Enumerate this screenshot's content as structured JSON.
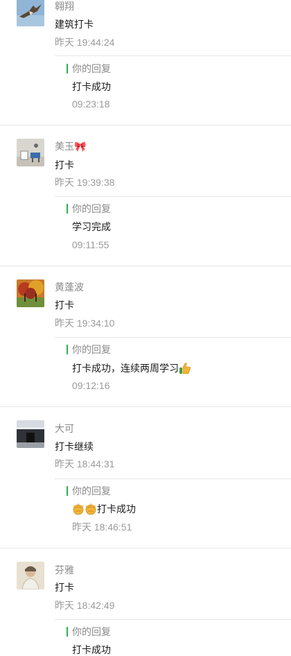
{
  "comments": [
    {
      "avatar_icon": "hawk-avatar",
      "name": "翱翔",
      "content": "建筑打卡",
      "time": "昨天 19:44:24",
      "reply_label": "你的回复",
      "reply_text": "打卡成功",
      "reply_time": "09:23:18"
    },
    {
      "avatar_icon": "room-avatar",
      "name": "美玉🎀",
      "content": "打卡",
      "time": "昨天 19:39:38",
      "reply_label": "你的回复",
      "reply_text": "学习完成",
      "reply_time": "09:11:55"
    },
    {
      "avatar_icon": "autumn-tree-avatar",
      "name": "黄蓬波",
      "content": "打卡",
      "time": "昨天 19:34:10",
      "reply_label": "你的回复",
      "reply_text": "打卡成功，连续两周学习",
      "reply_emoji": "thumbs-up-icon",
      "reply_time": "09:12:16"
    },
    {
      "avatar_icon": "building-avatar",
      "name": "大可",
      "content": "打卡继续",
      "time": "昨天 18:44:31",
      "reply_label": "你的回复",
      "reply_emoji_prefix": "fist-icon",
      "reply_text": "打卡成功",
      "reply_time": "昨天 18:46:51"
    },
    {
      "avatar_icon": "person-avatar",
      "name": "芬雅",
      "content": "打卡",
      "time": "昨天 18:42:49",
      "reply_label": "你的回复",
      "reply_text": "打卡成功"
    }
  ],
  "colors": {
    "accent": "#2bb24c",
    "divider": "#e6e6e6",
    "secondary_text": "#8a8a8a"
  }
}
